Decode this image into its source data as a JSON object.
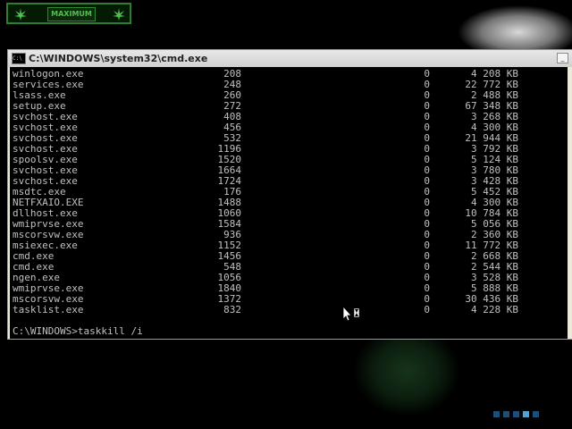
{
  "desktop": {
    "logo_text": "MAXIMUM",
    "taskbar_dots": [
      false,
      false,
      false,
      true,
      false
    ]
  },
  "window": {
    "title": "C:\\WINDOWS\\system32\\cmd.exe",
    "icon_label": "C:\\",
    "minimize_label": "_"
  },
  "process_rows": [
    {
      "name": "winlogon.exe",
      "pid": "208",
      "session": "0",
      "mem": "4 208 KB"
    },
    {
      "name": "services.exe",
      "pid": "248",
      "session": "0",
      "mem": "22 772 KB"
    },
    {
      "name": "lsass.exe",
      "pid": "260",
      "session": "0",
      "mem": "2 488 KB"
    },
    {
      "name": "setup.exe",
      "pid": "272",
      "session": "0",
      "mem": "67 348 KB"
    },
    {
      "name": "svchost.exe",
      "pid": "408",
      "session": "0",
      "mem": "3 268 KB"
    },
    {
      "name": "svchost.exe",
      "pid": "456",
      "session": "0",
      "mem": "4 300 KB"
    },
    {
      "name": "svchost.exe",
      "pid": "532",
      "session": "0",
      "mem": "21 944 KB"
    },
    {
      "name": "svchost.exe",
      "pid": "1196",
      "session": "0",
      "mem": "3 792 KB"
    },
    {
      "name": "spoolsv.exe",
      "pid": "1520",
      "session": "0",
      "mem": "5 124 KB"
    },
    {
      "name": "svchost.exe",
      "pid": "1664",
      "session": "0",
      "mem": "3 780 KB"
    },
    {
      "name": "svchost.exe",
      "pid": "1724",
      "session": "0",
      "mem": "3 428 KB"
    },
    {
      "name": "msdtc.exe",
      "pid": "176",
      "session": "0",
      "mem": "5 452 KB"
    },
    {
      "name": "NETFXAIO.EXE",
      "pid": "1488",
      "session": "0",
      "mem": "4 300 KB"
    },
    {
      "name": "dllhost.exe",
      "pid": "1060",
      "session": "0",
      "mem": "10 784 KB"
    },
    {
      "name": "wmiprvse.exe",
      "pid": "1584",
      "session": "0",
      "mem": "5 056 KB"
    },
    {
      "name": "mscorsvw.exe",
      "pid": "936",
      "session": "0",
      "mem": "2 360 KB"
    },
    {
      "name": "msiexec.exe",
      "pid": "1152",
      "session": "0",
      "mem": "11 772 KB"
    },
    {
      "name": "cmd.exe",
      "pid": "1456",
      "session": "0",
      "mem": "2 668 KB"
    },
    {
      "name": "cmd.exe",
      "pid": "548",
      "session": "0",
      "mem": "2 544 KB"
    },
    {
      "name": "ngen.exe",
      "pid": "1056",
      "session": "0",
      "mem": "3 528 KB"
    },
    {
      "name": "wmiprvse.exe",
      "pid": "1840",
      "session": "0",
      "mem": "5 888 KB"
    },
    {
      "name": "mscorsvw.exe",
      "pid": "1372",
      "session": "0",
      "mem": "30 436 KB"
    },
    {
      "name": "tasklist.exe",
      "pid": "832",
      "session": "0",
      "mem": "4 228 KB"
    }
  ],
  "prompt": {
    "text": "C:\\WINDOWS>taskkill /i"
  }
}
